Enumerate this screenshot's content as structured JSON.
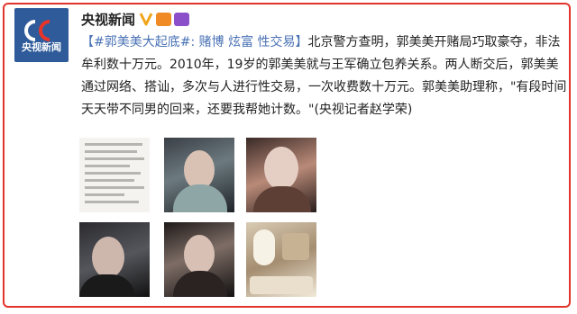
{
  "account": {
    "name": "央视新闻",
    "avatar_logo": "CCTV",
    "avatar_text": "央视新闻"
  },
  "post": {
    "topic": "【#郭美美大起底#: 赌博 炫富 性交易】",
    "body": "北京警方查明，郭美美开赌局巧取豪夺，非法牟利数十万元。2010年，19岁的郭美美就与王军确立包养关系。两人断交后，郭美美通过网络、搭讪，多次与人进行性交易，一次收费数十万元。郭美美助理称，\"有段时间天天带不同男的回来，还要我帮她计数。\"(央视记者赵学荣)"
  },
  "images": [
    {
      "name": "thumb-document",
      "icon": "document-image"
    },
    {
      "name": "thumb-portrait-1",
      "icon": "portrait-image"
    },
    {
      "name": "thumb-portrait-2",
      "icon": "portrait-image"
    },
    {
      "name": "thumb-car-selfie",
      "icon": "portrait-image"
    },
    {
      "name": "thumb-portrait-3",
      "icon": "portrait-image"
    },
    {
      "name": "thumb-room",
      "icon": "room-image"
    }
  ],
  "colors": {
    "frame_border": "#e3342a",
    "avatar_bg": "#2f5b9a",
    "topic_link": "#4a72b5",
    "verified": "#f0a51a"
  }
}
